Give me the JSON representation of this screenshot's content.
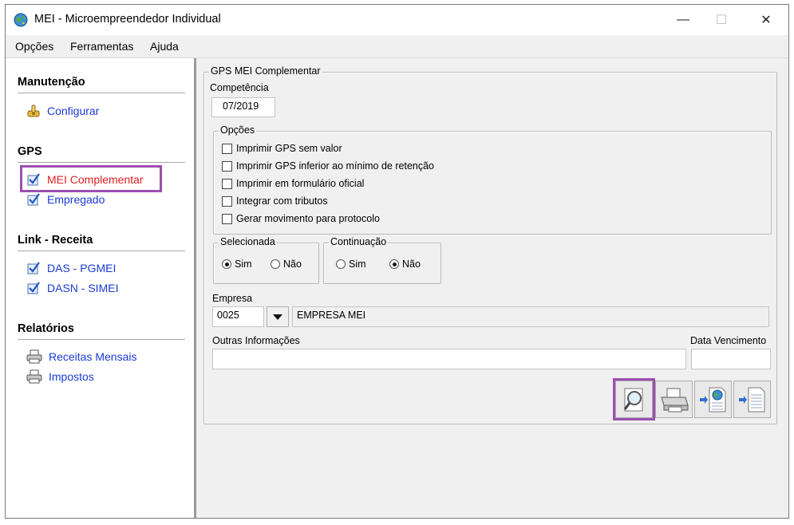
{
  "window": {
    "title": "MEI - Microempreendedor Individual",
    "minimize": "—",
    "maximize": "☐",
    "close": "✕"
  },
  "menu": [
    "Opções",
    "Ferramentas",
    "Ajuda"
  ],
  "sidebar": {
    "sections": [
      {
        "title": "Manutenção",
        "items": [
          {
            "label": "Configurar",
            "icon": "wrench-icon"
          }
        ]
      },
      {
        "title": "GPS",
        "items": [
          {
            "label": "MEI Complementar",
            "icon": "check-doc-icon",
            "active": true
          },
          {
            "label": "Empregado",
            "icon": "check-doc-icon"
          }
        ]
      },
      {
        "title": "Link - Receita",
        "items": [
          {
            "label": "DAS - PGMEI",
            "icon": "check-doc-icon"
          },
          {
            "label": "DASN - SIMEI",
            "icon": "check-doc-icon"
          }
        ]
      },
      {
        "title": "Relatórios",
        "items": [
          {
            "label": "Receitas Mensais",
            "icon": "printer-icon"
          },
          {
            "label": "Impostos",
            "icon": "printer-icon"
          }
        ]
      }
    ]
  },
  "form": {
    "group_title": "GPS MEI Complementar",
    "competencia_label": "Competência",
    "competencia_value": "07/2019",
    "opcoes_title": "Opções",
    "options": [
      {
        "label": "Imprimir GPS sem valor",
        "checked": false
      },
      {
        "label": "Imprimir GPS inferior ao mínimo de retenção",
        "checked": false
      },
      {
        "label": "Imprimir em formulário oficial",
        "checked": false
      },
      {
        "label": "Integrar com tributos",
        "checked": false
      },
      {
        "label": "Gerar movimento para protocolo",
        "checked": false
      }
    ],
    "selecionada": {
      "title": "Selecionada",
      "options": [
        "Sim",
        "Não"
      ],
      "selected": "Sim"
    },
    "continuacao": {
      "title": "Continuação",
      "options": [
        "Sim",
        "Não"
      ],
      "selected": "Não"
    },
    "empresa_label": "Empresa",
    "empresa_code": "0025",
    "empresa_name": "EMPRESA MEI",
    "outras_label": "Outras Informações",
    "outras_value": "",
    "vencimento_label": "Data Vencimento",
    "vencimento_value": ""
  },
  "toolbar": [
    {
      "name": "preview-button",
      "icon": "magnifier-icon",
      "selected": true
    },
    {
      "name": "print-button",
      "icon": "printer-icon"
    },
    {
      "name": "export-web-button",
      "icon": "globe-document-icon"
    },
    {
      "name": "export-file-button",
      "icon": "document-icon"
    }
  ],
  "colors": {
    "accent": "#9b4fb0",
    "link": "#1a3ad6",
    "active_link": "#e02020"
  }
}
